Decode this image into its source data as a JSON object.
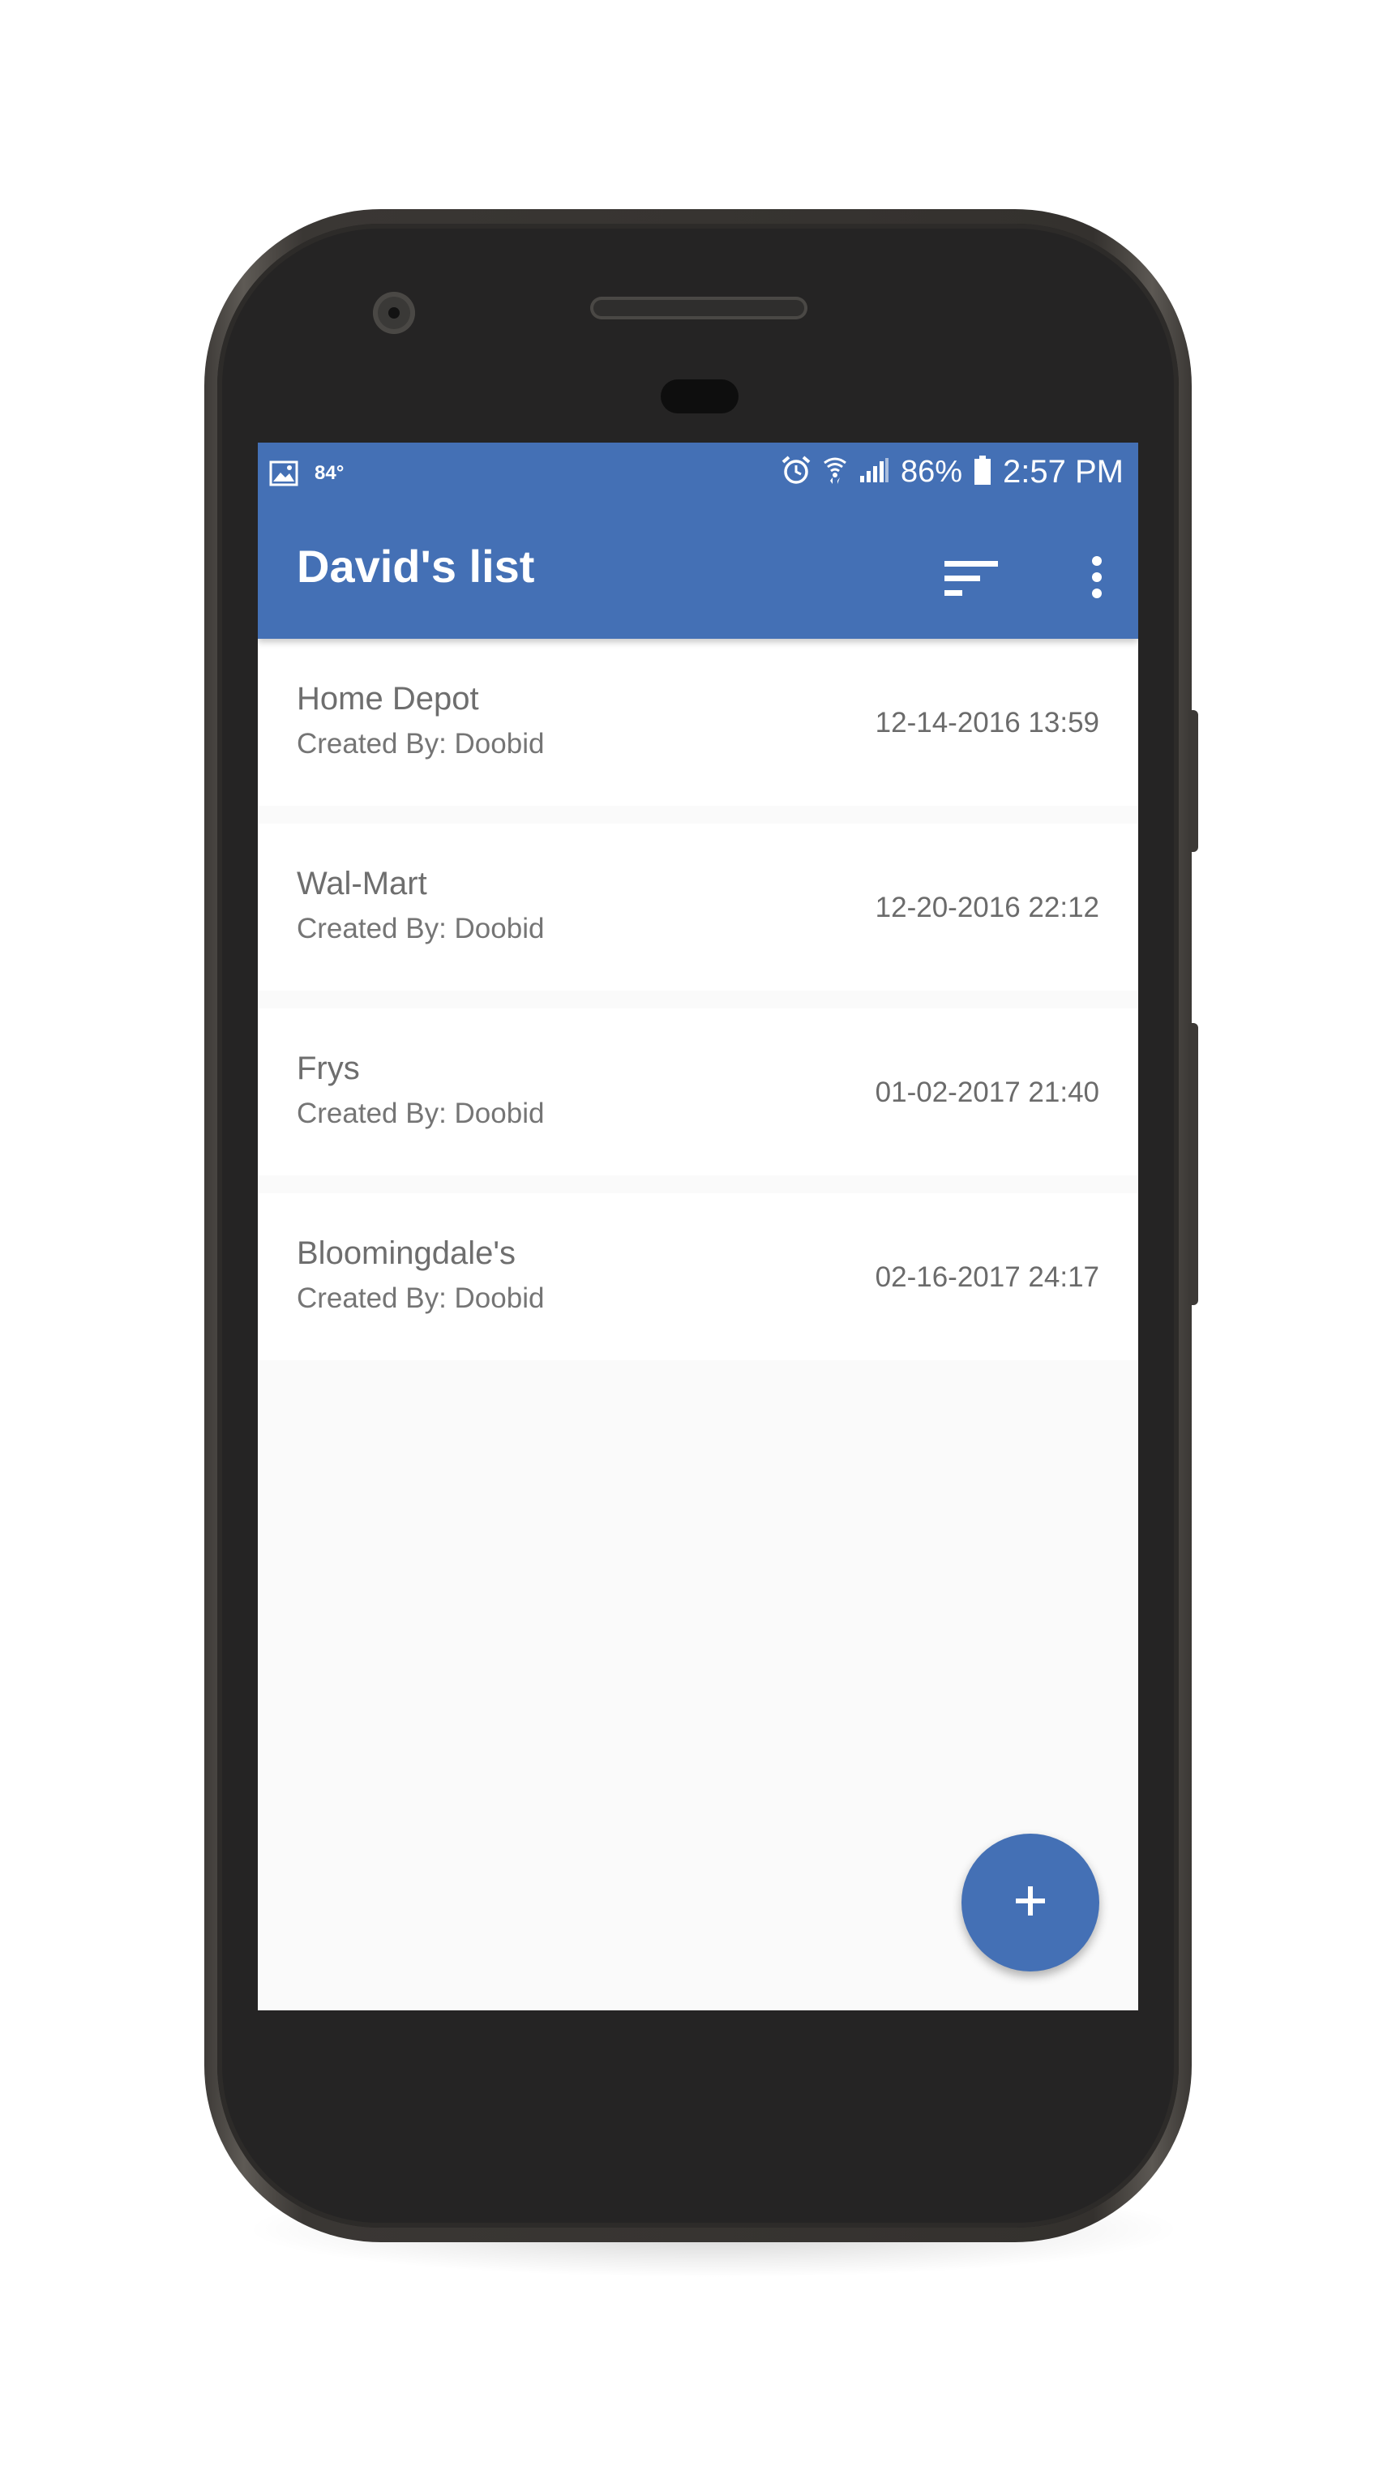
{
  "status_bar": {
    "temperature": "84°",
    "battery": "86%",
    "time": "2:57 PM"
  },
  "app_bar": {
    "title": "David's list",
    "sort_icon": "sort-icon",
    "more_icon": "more-vert-icon"
  },
  "lists": [
    {
      "name": "Home Depot",
      "created_by": "Created By: Doobid",
      "date": "12-14-2016 13:59"
    },
    {
      "name": "Wal-Mart",
      "created_by": "Created By: Doobid",
      "date": "12-20-2016 22:12"
    },
    {
      "name": "Frys",
      "created_by": "Created By: Doobid",
      "date": "01-02-2017 21:40"
    },
    {
      "name": "Bloomingdale's",
      "created_by": "Created By: Doobid",
      "date": "02-16-2017 24:17"
    }
  ],
  "fab": {
    "icon": "plus-icon"
  },
  "colors": {
    "primary": "#4470b5",
    "background": "#fafafa",
    "text_primary": "#6e6e6e"
  }
}
